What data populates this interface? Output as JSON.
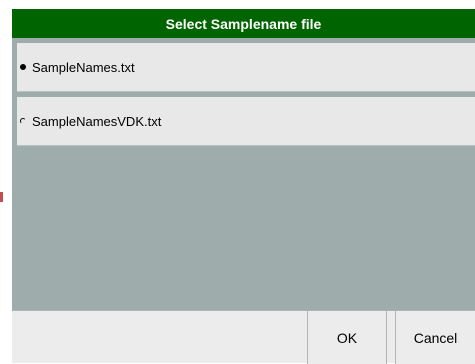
{
  "dialog": {
    "title": "Select Samplename file",
    "options": [
      {
        "label": "SampleNames.txt",
        "selected": true
      },
      {
        "label": "SampleNamesVDK.txt",
        "selected": false
      }
    ],
    "buttons": {
      "ok_label": "OK",
      "cancel_label": "Cancel"
    }
  },
  "colors": {
    "titlebar": "#006400",
    "background": "#9eacac",
    "option_background": "#e8e8e8"
  }
}
